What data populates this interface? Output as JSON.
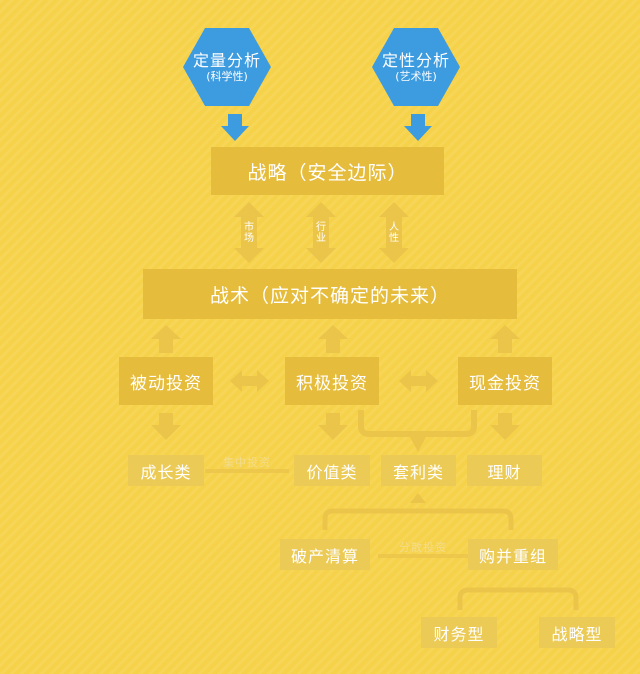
{
  "top_nodes": {
    "quantitative": {
      "title": "定量分析",
      "sub": "(科学性)"
    },
    "qualitative": {
      "title": "定性分析",
      "sub": "(艺术性)"
    }
  },
  "strategy": "战略（安全边际）",
  "tactics": "战术（应对不确定的未来）",
  "factor_labels": [
    "市场",
    "行业",
    "人性"
  ],
  "investment_styles": {
    "passive": "被动投资",
    "active": "积极投资",
    "cash": "现金投资"
  },
  "categories": {
    "growth": "成长类",
    "value": "价值类",
    "arbitrage": "套利类",
    "wealth": "理财"
  },
  "connector_labels": {
    "concentrated": "集中投资",
    "diversified": "分散投资"
  },
  "special": {
    "bankruptcy": "破产清算",
    "merger": "购并重组",
    "financial": "财务型",
    "strategic": "战略型"
  },
  "colors": {
    "background": "#f6d24a",
    "box": "#e6bc3c",
    "hexagon": "#3d9be0",
    "arrow_blue": "#3d9be0",
    "arrow_gold": "#ebc54a",
    "text": "#ffffff"
  }
}
